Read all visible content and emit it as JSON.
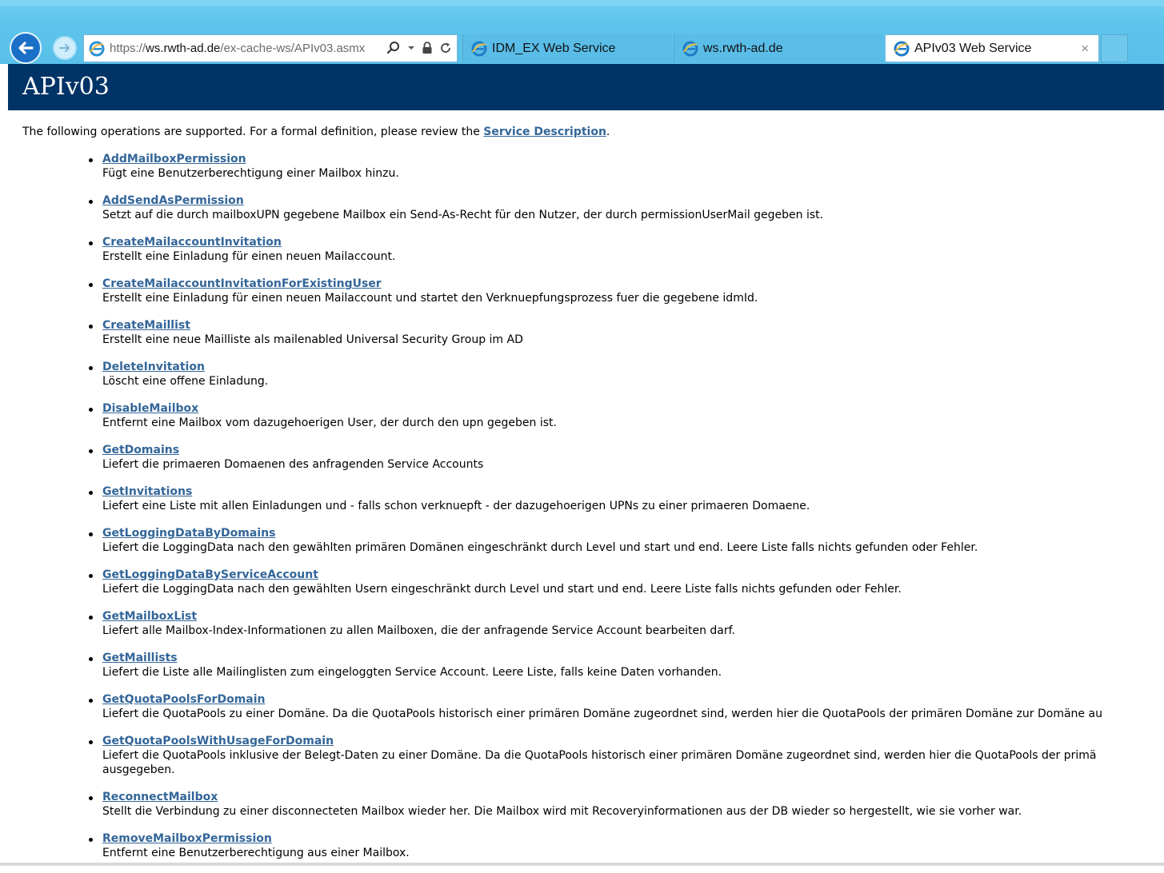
{
  "browser": {
    "address": {
      "scheme": "https://",
      "host": "ws.rwth-ad.de",
      "path": "/ex-cache-ws/APIv03.asmx"
    },
    "tabs": [
      {
        "label": "IDM_EX Web Service"
      },
      {
        "label": "ws.rwth-ad.de"
      },
      {
        "label": "APIv03 Web Service"
      }
    ],
    "tab_close": "×"
  },
  "page": {
    "title": "APIv03",
    "intro_text": "The following operations are supported. For a formal definition, please review the ",
    "intro_link": "Service Description",
    "intro_end": ".",
    "operations": [
      {
        "name": "AddMailboxPermission",
        "desc": "Fügt eine Benutzerberechtigung einer Mailbox hinzu."
      },
      {
        "name": "AddSendAsPermission",
        "desc": "Setzt auf die durch mailboxUPN gegebene Mailbox ein Send-As-Recht für den Nutzer, der durch permissionUserMail gegeben ist."
      },
      {
        "name": "CreateMailaccountInvitation",
        "desc": "Erstellt eine Einladung für einen neuen Mailaccount."
      },
      {
        "name": "CreateMailaccountInvitationForExistingUser",
        "desc": "Erstellt eine Einladung für einen neuen Mailaccount und startet den Verknuepfungsprozess fuer die gegebene idmId."
      },
      {
        "name": "CreateMaillist",
        "desc": "Erstellt eine neue Mailliste als mailenabled Universal Security Group im AD"
      },
      {
        "name": "DeleteInvitation",
        "desc": "Löscht eine offene Einladung."
      },
      {
        "name": "DisableMailbox",
        "desc": "Entfernt eine Mailbox vom dazugehoerigen User, der durch den upn gegeben ist."
      },
      {
        "name": "GetDomains",
        "desc": "Liefert die primaeren Domaenen des anfragenden Service Accounts"
      },
      {
        "name": "GetInvitations",
        "desc": "Liefert eine Liste mit allen Einladungen und - falls schon verknuepft - der dazugehoerigen UPNs zu einer primaeren Domaene."
      },
      {
        "name": "GetLoggingDataByDomains",
        "desc": "Liefert die LoggingData nach den gewählten primären Domänen eingeschränkt durch Level und start und end. Leere Liste falls nichts gefunden oder Fehler."
      },
      {
        "name": "GetLoggingDataByServiceAccount",
        "desc": "Liefert die LoggingData nach den gewählten Usern eingeschränkt durch Level und start und end. Leere Liste falls nichts gefunden oder Fehler."
      },
      {
        "name": "GetMailboxList",
        "desc": "Liefert alle Mailbox-Index-Informationen zu allen Mailboxen, die der anfragende Service Account bearbeiten darf."
      },
      {
        "name": "GetMaillists",
        "desc": "Liefert die Liste alle Mailinglisten zum eingeloggten Service Account. Leere Liste, falls keine Daten vorhanden."
      },
      {
        "name": "GetQuotaPoolsForDomain",
        "desc": "Liefert die QuotaPools zu einer Domäne. Da die QuotaPools historisch einer primären Domäne zugeordnet sind, werden hier die QuotaPools der primären Domäne zur Domäne au"
      },
      {
        "name": "GetQuotaPoolsWithUsageForDomain",
        "desc": "Liefert die QuotaPools inklusive der Belegt-Daten zu einer Domäne. Da die QuotaPools historisch einer primären Domäne zugeordnet sind, werden hier die QuotaPools der primä ausgegeben."
      },
      {
        "name": "ReconnectMailbox",
        "desc": "Stellt die Verbindung zu einer disconnecteten Mailbox wieder her. Die Mailbox wird mit Recoveryinformationen aus der DB wieder so hergestellt, wie sie vorher war."
      },
      {
        "name": "RemoveMailboxPermission",
        "desc": "Entfernt eine Benutzerberechtigung aus einer Mailbox."
      }
    ]
  }
}
